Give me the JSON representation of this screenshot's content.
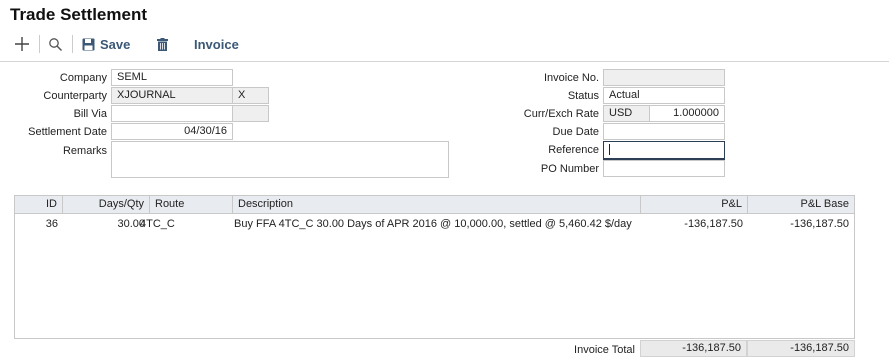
{
  "title": "Trade Settlement",
  "toolbar": {
    "add_icon": "plus-icon",
    "search_icon": "search-icon",
    "save_label": "Save",
    "delete_icon": "trash-icon",
    "invoice_label": "Invoice"
  },
  "form_left": {
    "company_label": "Company",
    "company_value": "SEML",
    "counterparty_label": "Counterparty",
    "counterparty_value": "XJOURNAL",
    "counterparty_suffix": "X",
    "billvia_label": "Bill Via",
    "billvia_value": "",
    "settlement_date_label": "Settlement Date",
    "settlement_date_value": "04/30/16",
    "remarks_label": "Remarks",
    "remarks_value": ""
  },
  "form_right": {
    "invoice_no_label": "Invoice No.",
    "invoice_no_value": "",
    "status_label": "Status",
    "status_value": "Actual",
    "curr_label": "Curr/Exch Rate",
    "curr_value": "USD",
    "rate_value": "1.000000",
    "due_date_label": "Due Date",
    "due_date_value": "",
    "reference_label": "Reference",
    "reference_value": "",
    "po_label": "PO Number",
    "po_value": ""
  },
  "grid": {
    "columns": [
      "ID",
      "Days/Qty",
      "Route",
      "Description",
      "P&L",
      "P&L Base"
    ],
    "rows": [
      {
        "id": "36",
        "days_qty": "30.00",
        "route": "4TC_C",
        "description": "Buy FFA 4TC_C 30.00 Days of APR 2016 @ 10,000.00, settled @ 5,460.42 $/day",
        "pnl": "-136,187.50",
        "pnl_base": "-136,187.50"
      }
    ]
  },
  "totals": {
    "label": "Invoice Total",
    "pnl": "-136,187.50",
    "pnl_base": "-136,187.50"
  },
  "colors": {
    "toolbar_text": "#3b5876",
    "grid_header_bg": "#e8ebf0",
    "readonly_bg": "#efefef"
  }
}
